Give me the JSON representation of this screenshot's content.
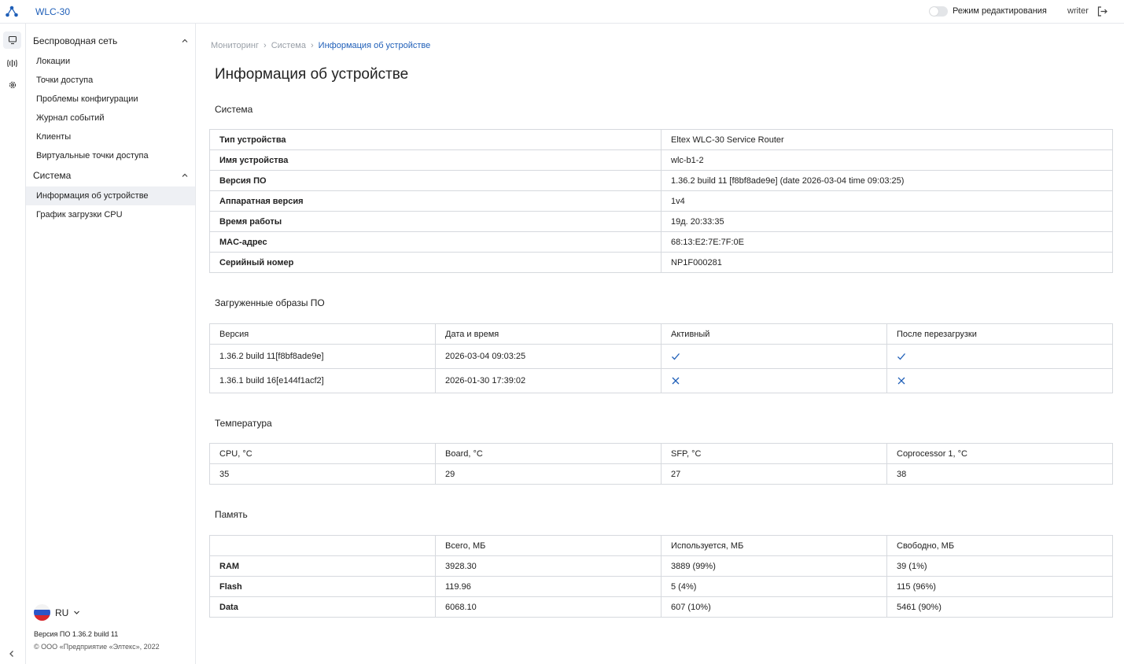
{
  "app": {
    "title": "WLC-30"
  },
  "header": {
    "edit_mode_label": "Режим редактирования",
    "user": "writer"
  },
  "sidebar": {
    "groups": [
      {
        "label": "Беспроводная сеть",
        "items": [
          {
            "label": "Локации"
          },
          {
            "label": "Точки доступа"
          },
          {
            "label": "Проблемы конфигурации"
          },
          {
            "label": "Журнал событий"
          },
          {
            "label": "Клиенты"
          },
          {
            "label": "Виртуальные точки доступа"
          }
        ]
      },
      {
        "label": "Система",
        "items": [
          {
            "label": "Информация об устройстве",
            "active": true
          },
          {
            "label": "График загрузки CPU"
          }
        ]
      }
    ],
    "language": "RU",
    "version_note": "Версия ПО 1.36.2 build 11",
    "copyright": "© ООО «Предприятие «Элтекс», 2022"
  },
  "breadcrumb": [
    "Мониторинг",
    "Система",
    "Информация об устройстве"
  ],
  "page_title": "Информация об устройстве",
  "system": {
    "title": "Система",
    "rows": [
      {
        "key": "Тип устройства",
        "value": "Eltex WLC-30 Service Router"
      },
      {
        "key": "Имя устройства",
        "value": "wlc-b1-2"
      },
      {
        "key": "Версия ПО",
        "value": "1.36.2 build 11 [f8bf8ade9e] (date 2026-03-04 time 09:03:25)"
      },
      {
        "key": "Аппаратная версия",
        "value": "1v4"
      },
      {
        "key": "Время работы",
        "value": "19д. 20:33:35"
      },
      {
        "key": "MAC-адрес",
        "value": "68:13:E2:7E:7F:0E"
      },
      {
        "key": "Серийный номер",
        "value": "NP1F000281"
      }
    ]
  },
  "images": {
    "title": "Загруженные образы ПО",
    "headers": [
      "Версия",
      "Дата и время",
      "Активный",
      "После перезагрузки"
    ],
    "rows": [
      {
        "version": "1.36.2 build 11[f8bf8ade9e]",
        "datetime": "2026-03-04 09:03:25",
        "active": true,
        "after_reboot": true
      },
      {
        "version": "1.36.1 build 16[e144f1acf2]",
        "datetime": "2026-01-30 17:39:02",
        "active": false,
        "after_reboot": false
      }
    ]
  },
  "temperature": {
    "title": "Температура",
    "headers": [
      "CPU, °C",
      "Board, °C",
      "SFP, °C",
      "Coprocessor 1, °C"
    ],
    "values": [
      "35",
      "29",
      "27",
      "38"
    ]
  },
  "memory": {
    "title": "Память",
    "headers": [
      "",
      "Всего, МБ",
      "Используется, МБ",
      "Свободно, МБ"
    ],
    "rows": [
      {
        "name": "RAM",
        "total": "3928.30",
        "used": "3889 (99%)",
        "free": "39 (1%)"
      },
      {
        "name": "Flash",
        "total": "119.96",
        "used": "5 (4%)",
        "free": "115 (96%)"
      },
      {
        "name": "Data",
        "total": "6068.10",
        "used": "607 (10%)",
        "free": "5461 (90%)"
      }
    ]
  },
  "colors": {
    "accent": "#1f5fb8",
    "border": "#d6d9de",
    "active_bg": "#eef0f4"
  }
}
